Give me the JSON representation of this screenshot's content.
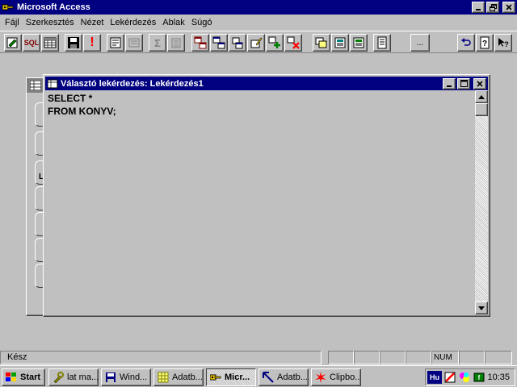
{
  "app": {
    "title": "Microsoft Access"
  },
  "menu": [
    {
      "label": "Fájl"
    },
    {
      "label": "Szerkesztés"
    },
    {
      "label": "Nézet"
    },
    {
      "label": "Lekérdezés"
    },
    {
      "label": "Ablak"
    },
    {
      "label": "Súgó"
    }
  ],
  "toolbar": {
    "sql_label": "SQL",
    "run_label": "!",
    "sum_label": "Σ",
    "build_label": "..."
  },
  "query_window": {
    "title": "Választó lekérdezés: Lekérdezés1",
    "sql_line1": "SELECT *",
    "sql_line2": "FROM KONYV;"
  },
  "db_window": {
    "tab_letter": "L"
  },
  "status": {
    "text": "Kész",
    "num": "NUM"
  },
  "taskbar": {
    "start": "Start",
    "tasks": [
      {
        "label": "lat ma..."
      },
      {
        "label": "Wind..."
      },
      {
        "label": "Adatb..."
      },
      {
        "label": "Micr..."
      },
      {
        "label": "Adatb..."
      },
      {
        "label": "Clipbo..."
      }
    ],
    "tray_lang": "Hu",
    "clock": "10:35"
  },
  "colors": {
    "title_active": "#000080",
    "face": "#c0c0c0",
    "run_red": "#ff0000"
  }
}
